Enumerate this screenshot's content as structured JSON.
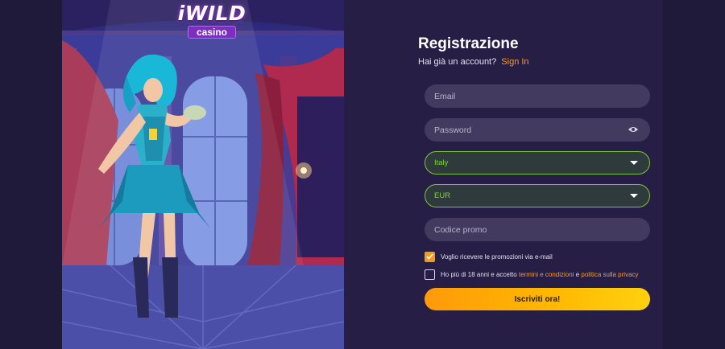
{
  "brand": {
    "logo_word": "iWILD",
    "logo_sub": "casino"
  },
  "form": {
    "title": "Registrazione",
    "subtitle_text": "Hai già un account?",
    "signin_link": "Sign In",
    "email_placeholder": "Email",
    "password_placeholder": "Password",
    "country_value": "Italy",
    "currency_value": "EUR",
    "promo_placeholder": "Codice promo",
    "promo_checkbox": {
      "label": "Voglio ricevere le promozioni via e-mail",
      "checked": true
    },
    "terms_checkbox": {
      "prefix": "Ho più di 18 anni e accetto",
      "terms_link": "termini e condizioni",
      "and": "e",
      "privacy_link": "politica sulla privacy",
      "checked": false
    },
    "submit_label": "Iscriviti ora!"
  },
  "icons": {
    "password_toggle": "eye-icon",
    "select_caret": "caret-down-icon",
    "checkmark": "check-icon"
  },
  "colors": {
    "accent": "#ff9a1f",
    "select_border": "#7cc43c",
    "panel_bg": "#261e45",
    "input_bg": "#433b5f"
  }
}
